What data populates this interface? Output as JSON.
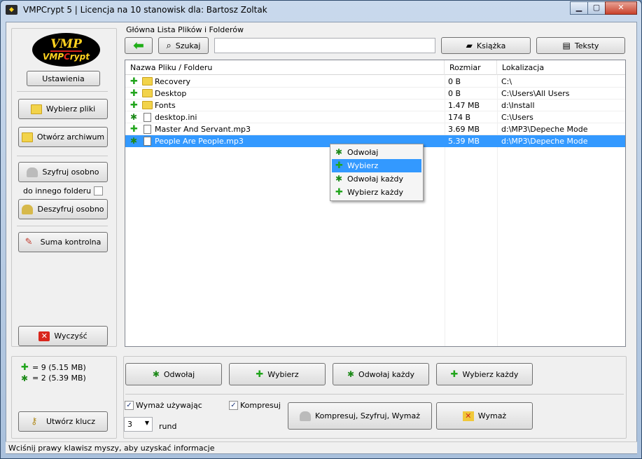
{
  "window": {
    "title": "VMPCrypt 5  |  Licencja na 10 stanowisk dla: Bartosz Zoltak"
  },
  "logo": {
    "line1": "VMP",
    "line2a": "VMP",
    "line2b": "C",
    "line2c": "rypt"
  },
  "left": {
    "settings": "Ustawienia",
    "select_files": "Wybierz pliki",
    "open_archive": "Otwórz archiwum",
    "encrypt_separately": "Szyfruj osobno",
    "to_other_folder": "do innego folderu",
    "decrypt_separately": "Deszyfruj osobno",
    "checksum": "Suma kontrolna",
    "clear": "Wyczyść",
    "stats_plus": "= 9  (5.15 MB)",
    "stats_x": "= 2  (5.39 MB)",
    "create_key": "Utwórz klucz"
  },
  "main": {
    "group_label": "Główna Lista Plików i Folderów",
    "search": "Szukaj",
    "search_value": "",
    "book": "Książka",
    "texts": "Teksty",
    "columns": [
      "Nazwa Pliku / Folderu",
      "Rozmiar",
      "Lokalizacja"
    ],
    "rows": [
      {
        "mark": "plus",
        "type": "folder",
        "name": "Recovery",
        "size": "0 B",
        "loc": "C:\\"
      },
      {
        "mark": "plus",
        "type": "folder",
        "name": "Desktop",
        "size": "0 B",
        "loc": "C:\\Users\\All Users"
      },
      {
        "mark": "plus",
        "type": "folder",
        "name": "Fonts",
        "size": "1.47 MB",
        "loc": "d:\\Install"
      },
      {
        "mark": "x",
        "type": "file",
        "name": "desktop.ini",
        "size": "174 B",
        "loc": "C:\\Users"
      },
      {
        "mark": "plus",
        "type": "file",
        "name": "Master And Servant.mp3",
        "size": "3.69 MB",
        "loc": "d:\\MP3\\Depeche Mode"
      },
      {
        "mark": "x",
        "type": "file",
        "name": "People Are People.mp3",
        "size": "5.39 MB",
        "loc": "d:\\MP3\\Depeche Mode",
        "selected": true
      }
    ]
  },
  "context_menu": [
    "Odwołaj",
    "Wybierz",
    "Odwołaj każdy",
    "Wybierz każdy"
  ],
  "bottom": {
    "cancel": "Odwołaj",
    "select": "Wybierz",
    "cancel_all": "Odwołaj każdy",
    "select_all": "Wybierz każdy",
    "wipe_using": "Wymaż używając",
    "compress": "Kompresuj",
    "rounds_value": "3",
    "rounds_label": "rund",
    "compress_encrypt_wipe": "Kompresuj, Szyfruj, Wymaż",
    "wipe": "Wymaż"
  },
  "status": "Wciśnij prawy klawisz myszy, aby uzyskać informacje"
}
